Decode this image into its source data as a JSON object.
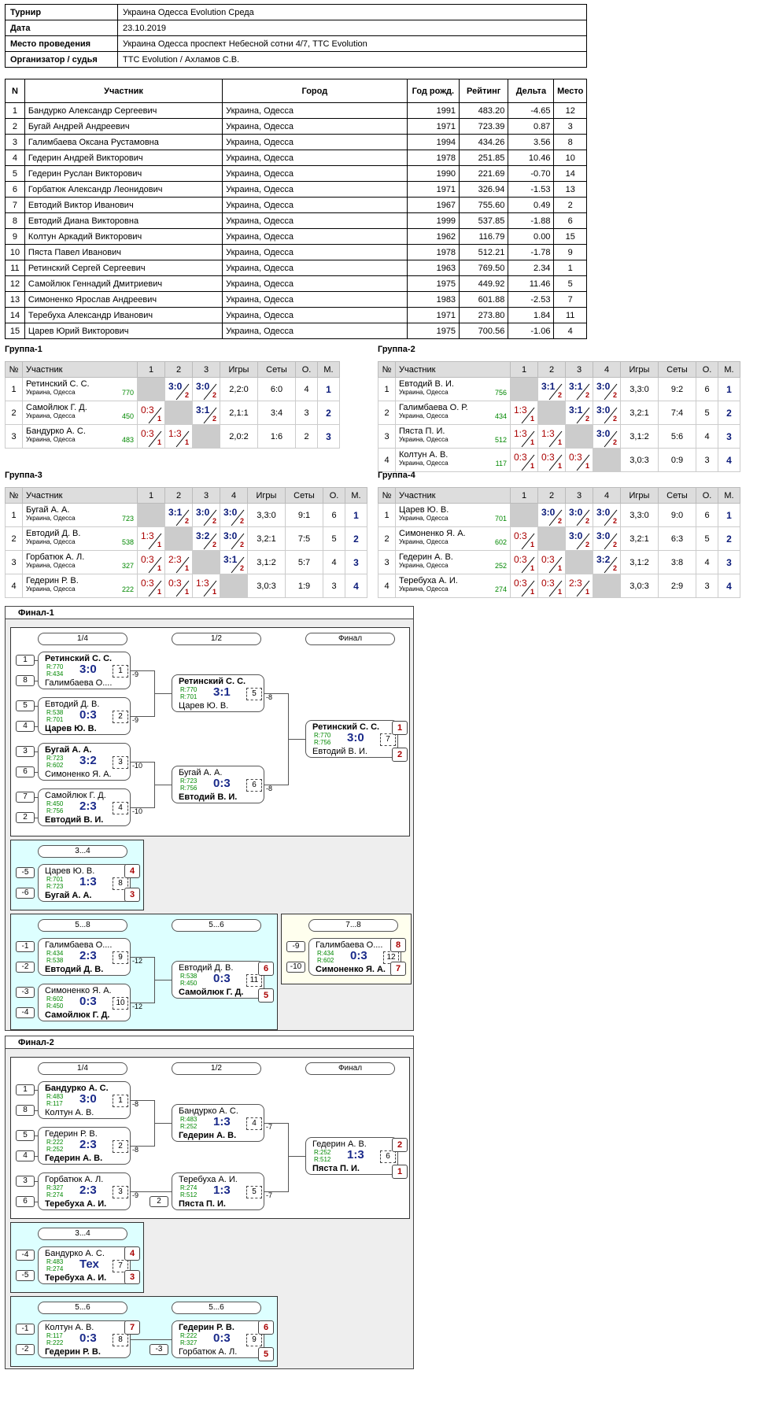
{
  "info": {
    "rows": [
      [
        "Турнир",
        "Украина Одесса Evolution Среда"
      ],
      [
        "Дата",
        "23.10.2019"
      ],
      [
        "Место проведения",
        "Украина Одесса проспект Небесной сотни 4/7, TTC Evolution"
      ],
      [
        "Организатор / судья",
        "TTC Evolution / Ахламов С.В."
      ]
    ]
  },
  "plist": {
    "headers": [
      "N",
      "Участник",
      "Город",
      "Год рожд.",
      "Рейтинг",
      "Дельта",
      "Место"
    ],
    "rows": [
      [
        "1",
        "Бандурко Александр Сергеевич",
        "Украина, Одесса",
        "1991",
        "483.20",
        "-4.65",
        "12"
      ],
      [
        "2",
        "Бугай Андрей Андреевич",
        "Украина, Одесса",
        "1971",
        "723.39",
        "0.87",
        "3"
      ],
      [
        "3",
        "Галимбаева Оксана Рустамовна",
        "Украина, Одесса",
        "1994",
        "434.26",
        "3.56",
        "8"
      ],
      [
        "4",
        "Гедерин Андрей Викторович",
        "Украина, Одесса",
        "1978",
        "251.85",
        "10.46",
        "10"
      ],
      [
        "5",
        "Гедерин Руслан Викторович",
        "Украина, Одесса",
        "1990",
        "221.69",
        "-0.70",
        "14"
      ],
      [
        "6",
        "Горбатюк Александр Леонидович",
        "Украина, Одесса",
        "1971",
        "326.94",
        "-1.53",
        "13"
      ],
      [
        "7",
        "Евтодий Виктор Иванович",
        "Украина, Одесса",
        "1967",
        "755.60",
        "0.49",
        "2"
      ],
      [
        "8",
        "Евтодий Диана Викторовна",
        "Украина, Одесса",
        "1999",
        "537.85",
        "-1.88",
        "6"
      ],
      [
        "9",
        "Колтун Аркадий Викторович",
        "Украина, Одесса",
        "1962",
        "116.79",
        "0.00",
        "15"
      ],
      [
        "10",
        "Пяста Павел Иванович",
        "Украина, Одесса",
        "1978",
        "512.21",
        "-1.78",
        "9"
      ],
      [
        "11",
        "Ретинский Сергей Сергеевич",
        "Украина, Одесса",
        "1963",
        "769.50",
        "2.34",
        "1"
      ],
      [
        "12",
        "Самойлюк Геннадий Дмитриевич",
        "Украина, Одесса",
        "1975",
        "449.92",
        "11.46",
        "5"
      ],
      [
        "13",
        "Симоненко Ярослав Андреевич",
        "Украина, Одесса",
        "1983",
        "601.88",
        "-2.53",
        "7"
      ],
      [
        "14",
        "Теребуха Александр Иванович",
        "Украина, Одесса",
        "1971",
        "273.80",
        "1.84",
        "11"
      ],
      [
        "15",
        "Царев Юрий Викторович",
        "Украина, Одесса",
        "1975",
        "700.56",
        "-1.06",
        "4"
      ]
    ]
  },
  "groups": {
    "headers": {
      "num": "№",
      "name": "Участник",
      "games": "Игры",
      "sets": "Сеты",
      "pts": "О.",
      "place": "М."
    },
    "city": "Украина, Одесса",
    "list": [
      {
        "title": "Группа-1",
        "players": [
          {
            "n": "1",
            "name": "Ретинский С. С.",
            "r": "770",
            "cells": [
              null,
              [
                "3:0",
                "2",
                "w"
              ],
              [
                "3:0",
                "2",
                "w"
              ]
            ],
            "games": "2,2:0",
            "sets": "6:0",
            "pts": "4",
            "place": "1"
          },
          {
            "n": "2",
            "name": "Самойлюк Г. Д.",
            "r": "450",
            "cells": [
              [
                "0:3",
                "1",
                "l"
              ],
              null,
              [
                "3:1",
                "2",
                "w"
              ]
            ],
            "games": "2,1:1",
            "sets": "3:4",
            "pts": "3",
            "place": "2"
          },
          {
            "n": "3",
            "name": "Бандурко А. С.",
            "r": "483",
            "cells": [
              [
                "0:3",
                "1",
                "l"
              ],
              [
                "1:3",
                "1",
                "l"
              ],
              null
            ],
            "games": "2,0:2",
            "sets": "1:6",
            "pts": "2",
            "place": "3"
          }
        ]
      },
      {
        "title": "Группа-2",
        "players": [
          {
            "n": "1",
            "name": "Евтодий В. И.",
            "r": "756",
            "cells": [
              null,
              [
                "3:1",
                "2",
                "w"
              ],
              [
                "3:1",
                "2",
                "w"
              ],
              [
                "3:0",
                "2",
                "w"
              ]
            ],
            "games": "3,3:0",
            "sets": "9:2",
            "pts": "6",
            "place": "1"
          },
          {
            "n": "2",
            "name": "Галимбаева О. Р.",
            "r": "434",
            "cells": [
              [
                "1:3",
                "1",
                "l"
              ],
              null,
              [
                "3:1",
                "2",
                "w"
              ],
              [
                "3:0",
                "2",
                "w"
              ]
            ],
            "games": "3,2:1",
            "sets": "7:4",
            "pts": "5",
            "place": "2"
          },
          {
            "n": "3",
            "name": "Пяста П. И.",
            "r": "512",
            "cells": [
              [
                "1:3",
                "1",
                "l"
              ],
              [
                "1:3",
                "1",
                "l"
              ],
              null,
              [
                "3:0",
                "2",
                "w"
              ]
            ],
            "games": "3,1:2",
            "sets": "5:6",
            "pts": "4",
            "place": "3"
          },
          {
            "n": "4",
            "name": "Колтун А. В.",
            "r": "117",
            "cells": [
              [
                "0:3",
                "1",
                "l"
              ],
              [
                "0:3",
                "1",
                "l"
              ],
              [
                "0:3",
                "1",
                "l"
              ],
              null
            ],
            "games": "3,0:3",
            "sets": "0:9",
            "pts": "3",
            "place": "4"
          }
        ]
      },
      {
        "title": "Группа-3",
        "players": [
          {
            "n": "1",
            "name": "Бугай А. А.",
            "r": "723",
            "cells": [
              null,
              [
                "3:1",
                "2",
                "w"
              ],
              [
                "3:0",
                "2",
                "w"
              ],
              [
                "3:0",
                "2",
                "w"
              ]
            ],
            "games": "3,3:0",
            "sets": "9:1",
            "pts": "6",
            "place": "1"
          },
          {
            "n": "2",
            "name": "Евтодий Д. В.",
            "r": "538",
            "cells": [
              [
                "1:3",
                "1",
                "l"
              ],
              null,
              [
                "3:2",
                "2",
                "w"
              ],
              [
                "3:0",
                "2",
                "w"
              ]
            ],
            "games": "3,2:1",
            "sets": "7:5",
            "pts": "5",
            "place": "2"
          },
          {
            "n": "3",
            "name": "Горбатюк А. Л.",
            "r": "327",
            "cells": [
              [
                "0:3",
                "1",
                "l"
              ],
              [
                "2:3",
                "1",
                "l"
              ],
              null,
              [
                "3:1",
                "2",
                "w"
              ]
            ],
            "games": "3,1:2",
            "sets": "5:7",
            "pts": "4",
            "place": "3"
          },
          {
            "n": "4",
            "name": "Гедерин Р. В.",
            "r": "222",
            "cells": [
              [
                "0:3",
                "1",
                "l"
              ],
              [
                "0:3",
                "1",
                "l"
              ],
              [
                "1:3",
                "1",
                "l"
              ],
              null
            ],
            "games": "3,0:3",
            "sets": "1:9",
            "pts": "3",
            "place": "4"
          }
        ]
      },
      {
        "title": "Группа-4",
        "players": [
          {
            "n": "1",
            "name": "Царев Ю. В.",
            "r": "701",
            "cells": [
              null,
              [
                "3:0",
                "2",
                "w"
              ],
              [
                "3:0",
                "2",
                "w"
              ],
              [
                "3:0",
                "2",
                "w"
              ]
            ],
            "games": "3,3:0",
            "sets": "9:0",
            "pts": "6",
            "place": "1"
          },
          {
            "n": "2",
            "name": "Симоненко Я. А.",
            "r": "602",
            "cells": [
              [
                "0:3",
                "1",
                "l"
              ],
              null,
              [
                "3:0",
                "2",
                "w"
              ],
              [
                "3:0",
                "2",
                "w"
              ]
            ],
            "games": "3,2:1",
            "sets": "6:3",
            "pts": "5",
            "place": "2"
          },
          {
            "n": "3",
            "name": "Гедерин А. В.",
            "r": "252",
            "cells": [
              [
                "0:3",
                "1",
                "l"
              ],
              [
                "0:3",
                "1",
                "l"
              ],
              null,
              [
                "3:2",
                "2",
                "w"
              ]
            ],
            "games": "3,1:2",
            "sets": "3:8",
            "pts": "4",
            "place": "3"
          },
          {
            "n": "4",
            "name": "Теребуха А. И.",
            "r": "274",
            "cells": [
              [
                "0:3",
                "1",
                "l"
              ],
              [
                "0:3",
                "1",
                "l"
              ],
              [
                "2:3",
                "1",
                "l"
              ],
              null
            ],
            "games": "3,0:3",
            "sets": "2:9",
            "pts": "3",
            "place": "4"
          }
        ]
      }
    ]
  },
  "final1": {
    "title": "Финал-1",
    "r14": "1/4",
    "r12": "1/2",
    "rf": "Финал",
    "r34": "3...4",
    "r58": "5...8",
    "r56": "5...6",
    "r78": "7...8",
    "matches": [
      {
        "a": "Ретинский С. С.",
        "ra": "R:770",
        "b": "Галимбаева О....",
        "rb": "R:434",
        "s": "3:0",
        "g": "1",
        "wa": true,
        "sa": "1",
        "sb": "8",
        "ls": "-9"
      },
      {
        "a": "Евтодий Д. В.",
        "ra": "R:538",
        "b": "Царев Ю. В.",
        "rb": "R:701",
        "s": "0:3",
        "g": "2",
        "wa": false,
        "sa": "5",
        "sb": "4",
        "ls": "-9"
      },
      {
        "a": "Бугай А. А.",
        "ra": "R:723",
        "b": "Симоненко Я. А.",
        "rb": "R:602",
        "s": "3:2",
        "g": "3",
        "wa": true,
        "sa": "3",
        "sb": "6",
        "ls": "-10"
      },
      {
        "a": "Самойлюк Г. Д.",
        "ra": "R:450",
        "b": "Евтодий В. И.",
        "rb": "R:756",
        "s": "2:3",
        "g": "4",
        "wa": false,
        "sa": "7",
        "sb": "2",
        "ls": "-10"
      },
      {
        "a": "Ретинский С. С.",
        "ra": "R:770",
        "b": "Царев Ю. В.",
        "rb": "R:701",
        "s": "3:1",
        "g": "5",
        "wa": true,
        "ls": "-8"
      },
      {
        "a": "Бугай А. А.",
        "ra": "R:723",
        "b": "Евтодий В. И.",
        "rb": "R:756",
        "s": "0:3",
        "g": "6",
        "wa": false,
        "ls": "-8"
      },
      {
        "a": "Ретинский С. С.",
        "ra": "R:770",
        "b": "Евтодий В. И.",
        "rb": "R:756",
        "s": "3:0",
        "g": "7",
        "wa": true,
        "pa": "1",
        "pb": "2"
      },
      {
        "a": "Царев Ю. В.",
        "ra": "R:701",
        "b": "Бугай А. А.",
        "rb": "R:723",
        "s": "1:3",
        "g": "8",
        "wa": false,
        "pa": "4",
        "pb": "3",
        "sa": "-5",
        "sb": "-6"
      },
      {
        "a": "Галимбаева О....",
        "ra": "R:434",
        "b": "Евтодий Д. В.",
        "rb": "R:538",
        "s": "2:3",
        "g": "9",
        "wa": false,
        "sa": "-1",
        "sb": "-2",
        "ls": "-12"
      },
      {
        "a": "Симоненко Я. А.",
        "ra": "R:602",
        "b": "Самойлюк Г. Д.",
        "rb": "R:450",
        "s": "0:3",
        "g": "10",
        "wa": false,
        "sa": "-3",
        "sb": "-4",
        "ls": "-12"
      },
      {
        "a": "Евтодий Д. В.",
        "ra": "R:538",
        "b": "Самойлюк Г. Д.",
        "rb": "R:450",
        "s": "0:3",
        "g": "11",
        "wa": false,
        "pa": "6",
        "pb": "5"
      },
      {
        "a": "Галимбаева О....",
        "ra": "R:434",
        "b": "Симоненко Я. А.",
        "rb": "R:602",
        "s": "0:3",
        "g": "12",
        "wa": false,
        "pa": "8",
        "pb": "7",
        "sa": "-9",
        "sb": "-10"
      }
    ]
  },
  "final2": {
    "title": "Финал-2",
    "r14": "1/4",
    "r12": "1/2",
    "rf": "Финал",
    "r34": "3...4",
    "r56a": "5...6",
    "r56b": "5...6",
    "matches": [
      {
        "a": "Бандурко А. С.",
        "ra": "R:483",
        "b": "Колтун А. В.",
        "rb": "R:117",
        "s": "3:0",
        "g": "1",
        "wa": true,
        "sa": "1",
        "sb": "8",
        "ls": "-8"
      },
      {
        "a": "Гедерин Р. В.",
        "ra": "R:222",
        "b": "Гедерин А. В.",
        "rb": "R:252",
        "s": "2:3",
        "g": "2",
        "wa": false,
        "sa": "5",
        "sb": "4",
        "ls": "-8"
      },
      {
        "a": "Горбатюк А. Л.",
        "ra": "R:327",
        "b": "Теребуха А. И.",
        "rb": "R:274",
        "s": "2:3",
        "g": "3",
        "wa": false,
        "sa": "3",
        "sb": "6",
        "ls": "-9"
      },
      {
        "a": "Бандурко А. С.",
        "ra": "R:483",
        "b": "Гедерин А. В.",
        "rb": "R:252",
        "s": "1:3",
        "g": "4",
        "wa": false,
        "ls": "-7"
      },
      {
        "a": "Теребуха А. И.",
        "ra": "R:274",
        "b": "Пяста П. И.",
        "rb": "R:512",
        "s": "1:3",
        "g": "5",
        "wa": false,
        "sb": "2",
        "ls": "-7"
      },
      {
        "a": "Гедерин А. В.",
        "ra": "R:252",
        "b": "Пяста П. И.",
        "rb": "R:512",
        "s": "1:3",
        "g": "6",
        "wa": false,
        "pa": "2",
        "pb": "1"
      },
      {
        "a": "Бандурко А. С.",
        "ra": "R:483",
        "b": "Теребуха А. И.",
        "rb": "R:274",
        "s": "Тех",
        "g": "7",
        "wa": false,
        "pa": "4",
        "pb": "3",
        "sa": "-4",
        "sb": "-5"
      },
      {
        "a": "Колтун А. В.",
        "ra": "R:117",
        "b": "Гедерин Р. В.",
        "rb": "R:222",
        "s": "0:3",
        "g": "8",
        "wa": false,
        "pa": "7",
        "sa": "-1",
        "sb": "-2"
      },
      {
        "a": "Гедерин Р. В.",
        "ra": "R:222",
        "b": "Горбатюк А. Л.",
        "rb": "R:327",
        "s": "0:3",
        "g": "9",
        "wa": true,
        "pa": "6",
        "pb": "5",
        "sb": "-3"
      }
    ]
  }
}
